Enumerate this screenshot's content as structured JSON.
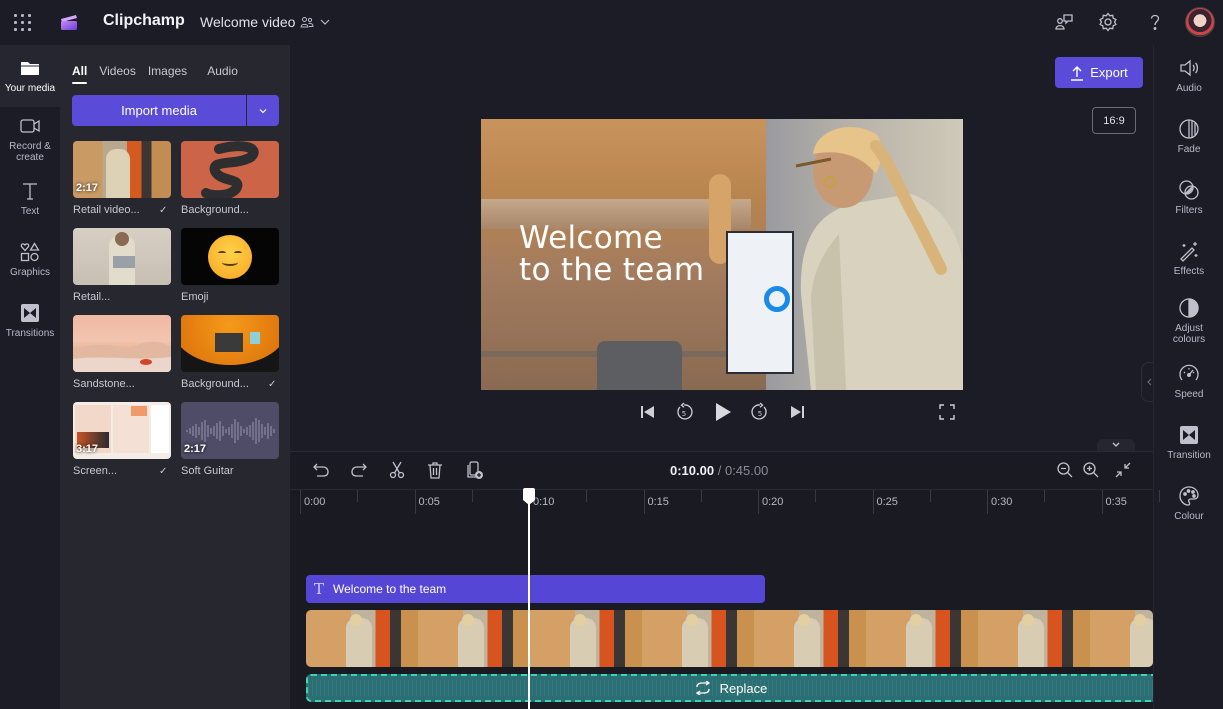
{
  "app": {
    "name": "Clipchamp",
    "project_name": "Welcome video",
    "icons": [
      "apps-grid-icon",
      "clipchamp-logo-icon",
      "share-people-icon",
      "chevron-down-icon",
      "feedback-icon",
      "settings-icon",
      "help-icon",
      "avatar"
    ]
  },
  "left_rail": {
    "items": [
      {
        "label": "Your media",
        "icon": "folder-icon",
        "active": true
      },
      {
        "label": "Record & create",
        "icon": "camera-icon"
      },
      {
        "label": "Text",
        "icon": "text-icon"
      },
      {
        "label": "Graphics",
        "icon": "shapes-icon"
      },
      {
        "label": "Transitions",
        "icon": "transition-icon"
      }
    ]
  },
  "media_panel": {
    "tabs": [
      {
        "label": "All",
        "active": true
      },
      {
        "label": "Videos"
      },
      {
        "label": "Images"
      },
      {
        "label": "Audio"
      }
    ],
    "import_label": "Import media",
    "items": [
      {
        "label": "Retail video...",
        "duration": "2:17",
        "checked": true,
        "kind": "video"
      },
      {
        "label": "Background...",
        "duration": "",
        "checked": false,
        "kind": "image"
      },
      {
        "label": "Retail...",
        "duration": "",
        "checked": false,
        "kind": "image"
      },
      {
        "label": "Emoji",
        "duration": "",
        "checked": false,
        "kind": "image"
      },
      {
        "label": "Sandstone...",
        "duration": "",
        "checked": false,
        "kind": "image"
      },
      {
        "label": "Background...",
        "duration": "",
        "checked": true,
        "kind": "image"
      },
      {
        "label": "Screen...",
        "duration": "3:17",
        "checked": true,
        "kind": "video"
      },
      {
        "label": "Soft Guitar",
        "duration": "2:17",
        "checked": false,
        "kind": "audio"
      }
    ]
  },
  "preview": {
    "export_label": "Export",
    "aspect_ratio": "16:9",
    "title_line1": "Welcome",
    "title_line2": "to the team",
    "controls": [
      "skip-back-icon",
      "rewind-5-icon",
      "play-icon",
      "forward-5-icon",
      "skip-forward-icon",
      "fullscreen-icon"
    ],
    "rewind_seconds": "5",
    "forward_seconds": "5"
  },
  "right_rail": {
    "items": [
      {
        "label": "Audio",
        "icon": "speaker-icon"
      },
      {
        "label": "Fade",
        "icon": "fade-icon"
      },
      {
        "label": "Filters",
        "icon": "filters-icon"
      },
      {
        "label": "Effects",
        "icon": "magic-wand-icon"
      },
      {
        "label": "Adjust colours",
        "icon": "contrast-icon"
      },
      {
        "label": "Speed",
        "icon": "speedometer-icon"
      },
      {
        "label": "Transition",
        "icon": "transition-icon"
      },
      {
        "label": "Colour",
        "icon": "palette-icon"
      }
    ]
  },
  "timeline": {
    "current_time": "0:10.00",
    "separator": "/",
    "total_time": "0:45.00",
    "tools": [
      "undo-icon",
      "redo-icon",
      "split-icon",
      "delete-icon",
      "add-media-icon"
    ],
    "zoom_tools": [
      "zoom-out-icon",
      "zoom-in-icon",
      "fit-icon"
    ],
    "ruler_labels": [
      "0:00",
      "0:05",
      "0:10",
      "0:15",
      "0:20",
      "0:25",
      "0:30",
      "0:35"
    ],
    "playhead_seconds": 10,
    "text_clip_label": "Welcome to the team",
    "audio_clip_label": "Replace",
    "colors": {
      "accent": "#5b4bd9",
      "text_clip": "#5646d6",
      "audio_clip": "#2b6e74",
      "audio_border": "#3fd4b0"
    }
  }
}
